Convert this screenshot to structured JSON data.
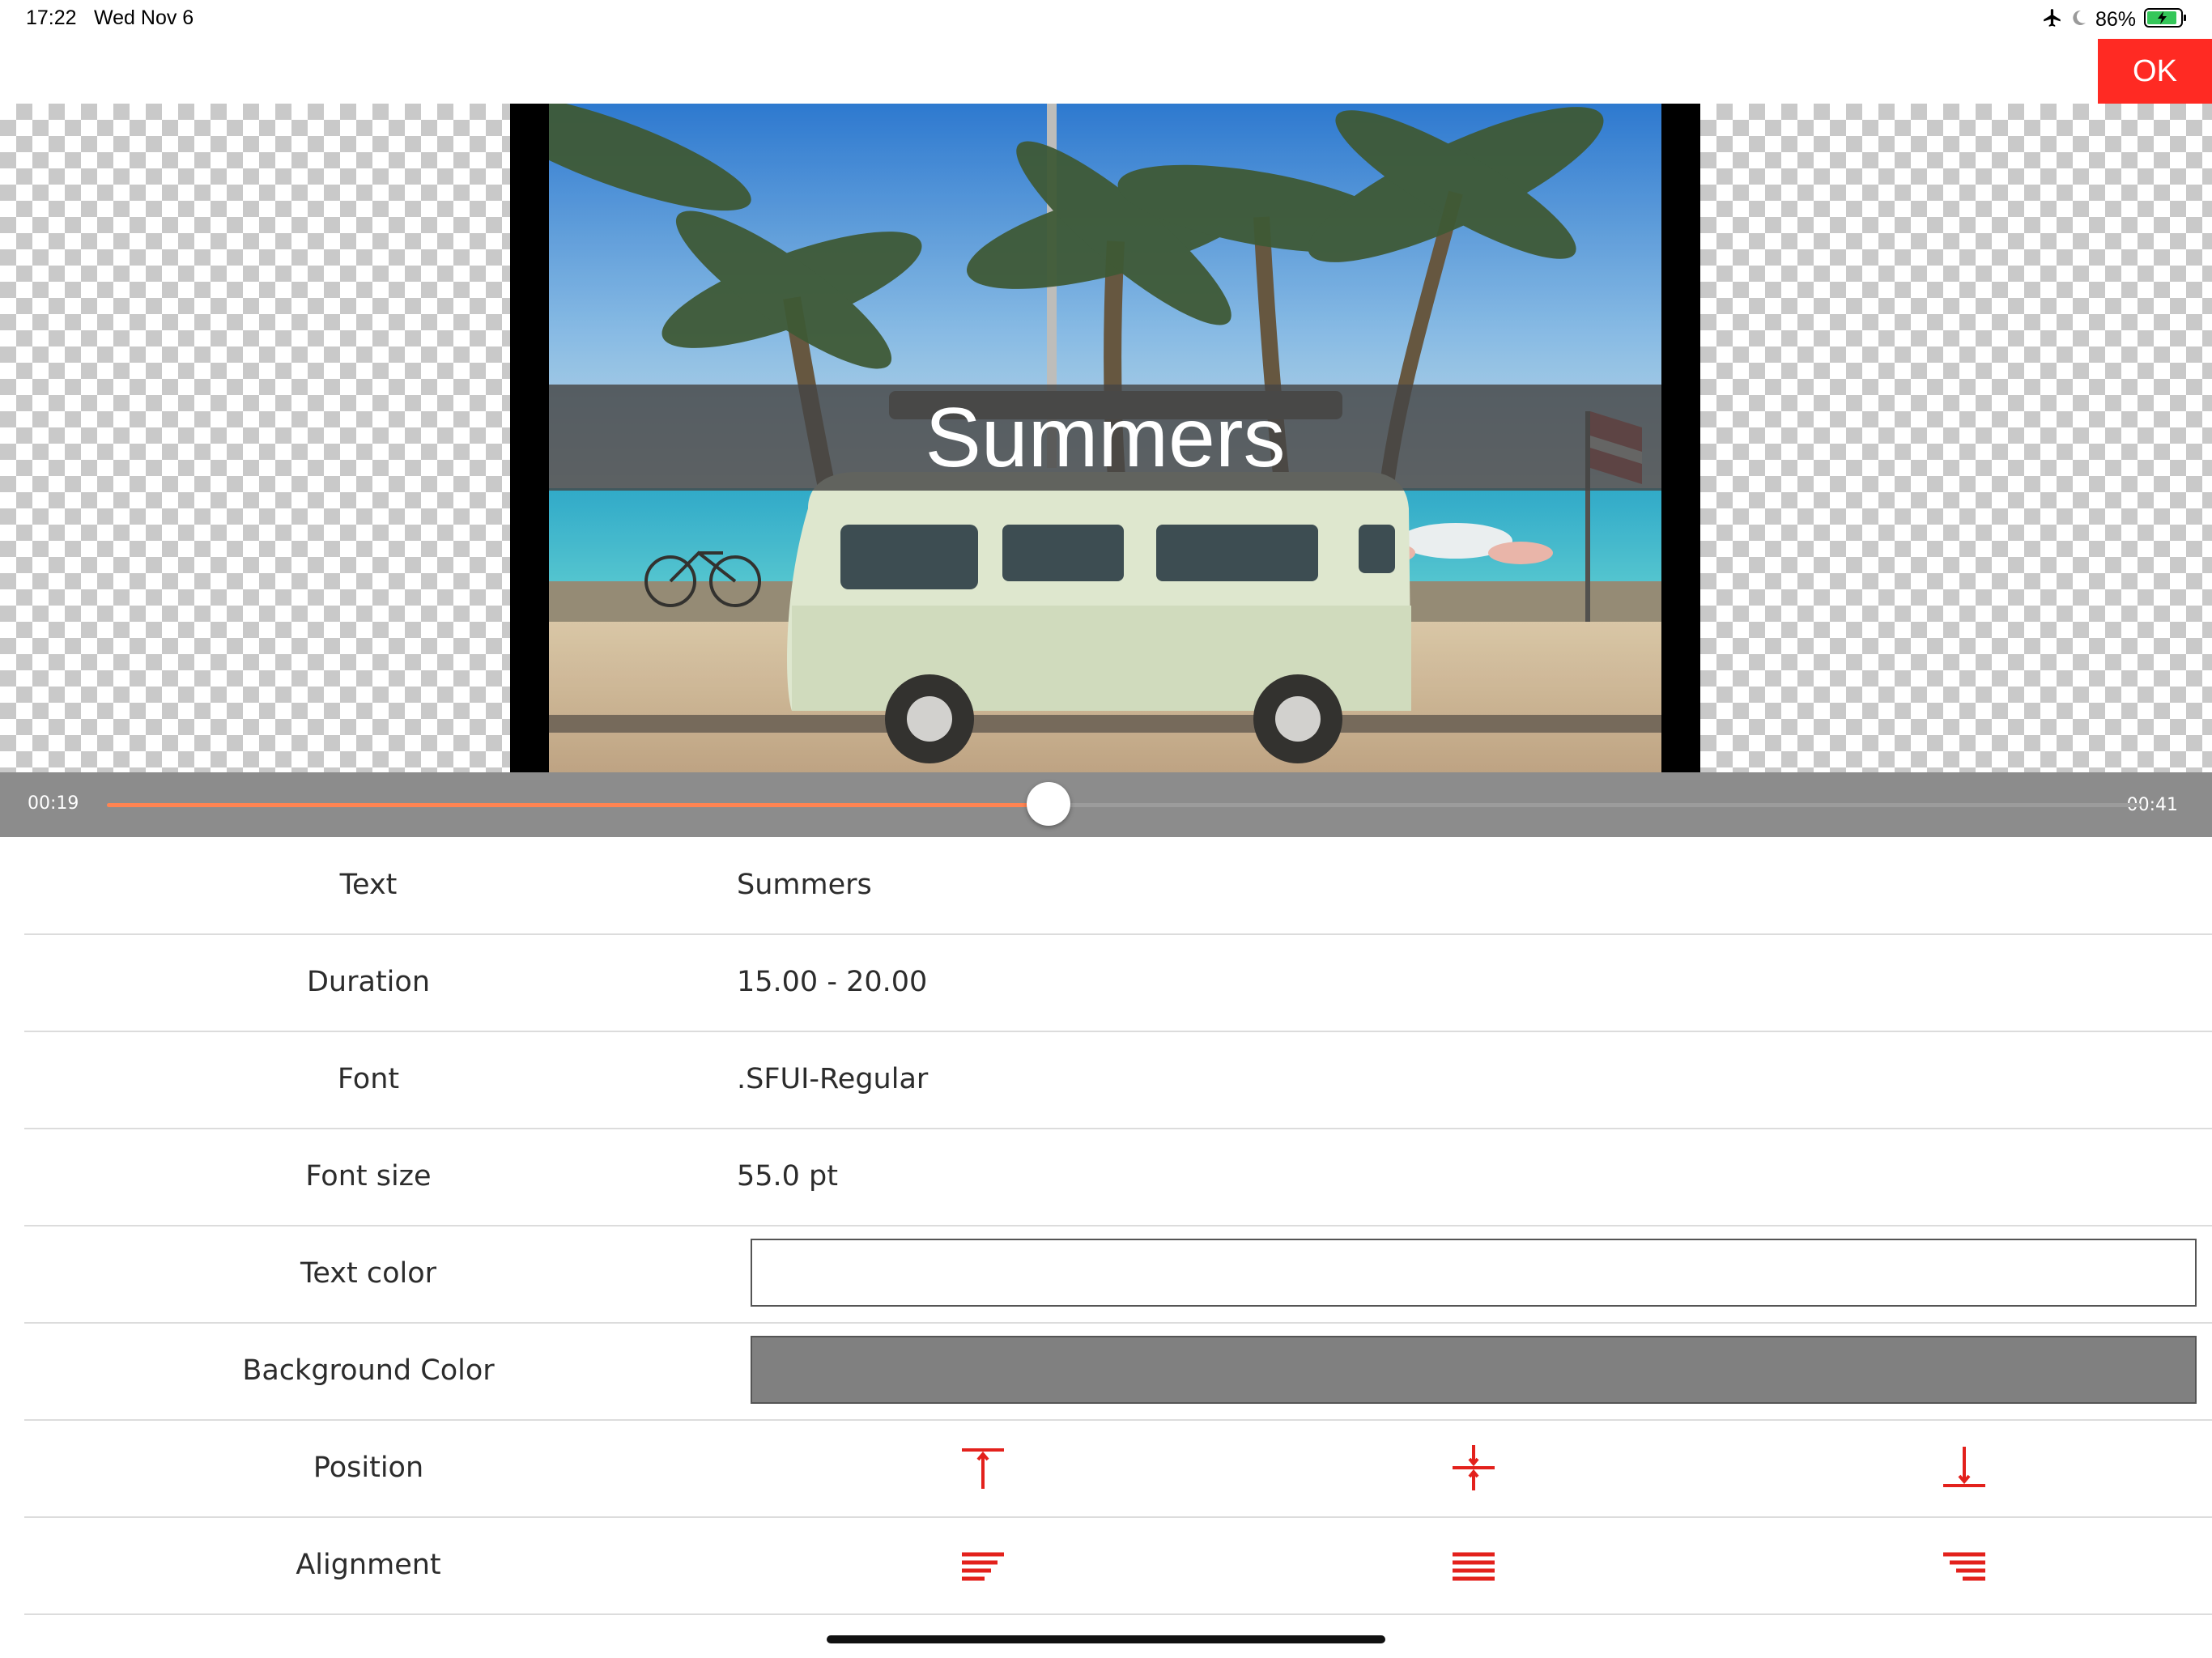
{
  "status_bar": {
    "time": "17:22",
    "date": "Wed Nov 6",
    "battery": "86%",
    "icons": [
      "airplane-icon",
      "moon-icon",
      "battery-charging-icon"
    ]
  },
  "toolbar": {
    "ok_label": "OK",
    "ok_color": "#ff2a23"
  },
  "preview": {
    "caption": "Summers",
    "caption_band_color": "#464646"
  },
  "scrubber": {
    "current_time": "00:19",
    "total_time": "00:41",
    "progress_fraction": 0.463,
    "progress_color": "#ff8452"
  },
  "settings": {
    "text": {
      "label": "Text",
      "value": "Summers"
    },
    "duration": {
      "label": "Duration",
      "value": "15.00 - 20.00"
    },
    "font": {
      "label": "Font",
      "value": ".SFUI-Regular"
    },
    "font_size": {
      "label": "Font size",
      "value": "55.0 pt"
    },
    "text_color": {
      "label": "Text color",
      "color": "#ffffff"
    },
    "background_color": {
      "label": "Background Color",
      "color": "#808080"
    },
    "position": {
      "label": "Position",
      "options": [
        "position-top-icon",
        "position-center-icon",
        "position-bottom-icon"
      ]
    },
    "alignment": {
      "label": "Alignment",
      "options": [
        "align-left-icon",
        "align-center-icon",
        "align-right-icon"
      ]
    },
    "accent_color": "#e3211c"
  }
}
